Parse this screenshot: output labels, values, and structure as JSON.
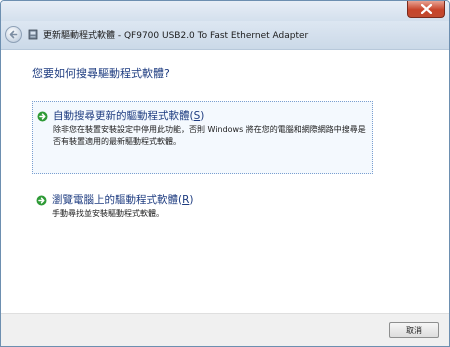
{
  "window": {
    "header_title": "更新驅動程式軟體 - QF9700 USB2.0 To Fast Ethernet Adapter"
  },
  "prompt": "您要如何搜尋驅動程式軟體?",
  "options": [
    {
      "title": "自動搜尋更新的驅動程式軟體",
      "mnemonic_open": "(",
      "mnemonic_key": "S",
      "mnemonic_close": ")",
      "description": "除非您在裝置安裝設定中停用此功能，否則 Windows 將在您的電腦和網際網路中搜尋是否有裝置適用的最新驅動程式軟體。",
      "icon": "green-arrow-icon"
    },
    {
      "title": "瀏覽電腦上的驅動程式軟體",
      "mnemonic_open": "(",
      "mnemonic_key": "R",
      "mnemonic_close": ")",
      "description": "手動尋找並安裝驅動程式軟體。",
      "icon": "green-arrow-icon"
    }
  ],
  "buttons": {
    "cancel": "取消"
  },
  "colors": {
    "link_blue": "#1e3c80",
    "close_red": "#c7442a",
    "arrow_green": "#2e9a36"
  }
}
